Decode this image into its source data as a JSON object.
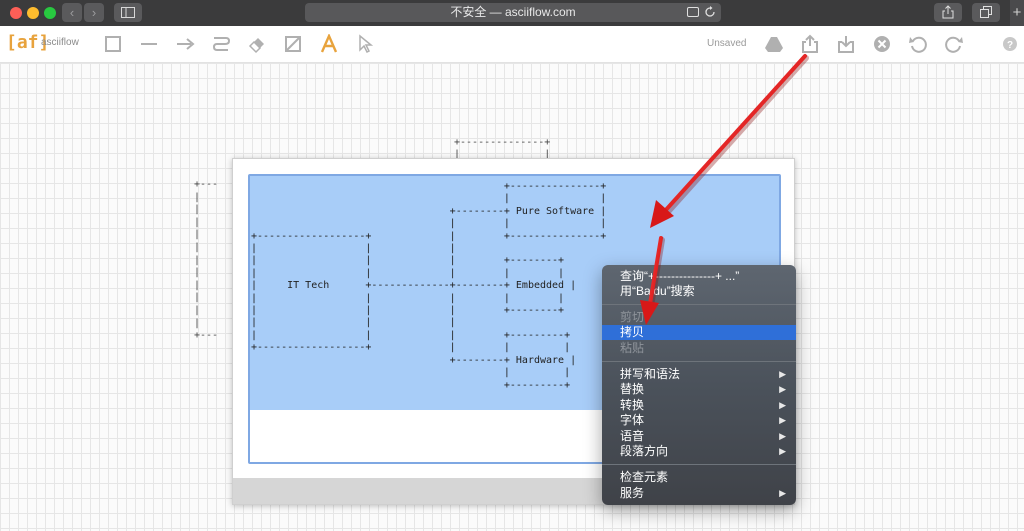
{
  "browser": {
    "url_text": "不安全 — asciiflow.com",
    "nav": {
      "back_glyph": "‹",
      "forward_glyph": "›"
    },
    "new_tab_glyph": "+"
  },
  "app": {
    "logo": "[af]",
    "name": "asciiflow",
    "status": "Unsaved",
    "accent_color": "#e8a33d"
  },
  "diagram": {
    "back_box_top": "+--------------+\n|              |",
    "back_box_left": "+---\n|\n|\n|\n|\n|\n|\n|\n|\n|\n|\n|\n+---",
    "text": "                                          +---------------+\n                                          |               |\n                                 +--------+ Pure Software |\n                                 |        |               |\n+------------------+             |        +---------------+\n|                  |             |\n|                  |             |        +--------+\n|                  |             |        |        |\n|     IT Tech      +-------------+--------+ Embedded |\n|                  |             |        |        |\n|                  |             |        +--------+\n|                  |             |\n|                  |             |        +---------+\n+------------------+             |        |         |\n                                 +--------+ Hardware |\n                                          |         |\n                                          +---------+"
  },
  "context_menu": {
    "lookup": "查询“+---------------+ ...”",
    "search": "用“Baidu”搜索",
    "cut": "剪切",
    "copy": "拷贝",
    "paste": "粘贴",
    "spelling": "拼写和语法",
    "substitutions": "替换",
    "transformations": "转换",
    "font": "字体",
    "speech": "语音",
    "direction": "段落方向",
    "inspect": "检查元素",
    "services": "服务",
    "submenu_glyph": "▶"
  },
  "colors": {
    "selection": "#a8cdf8",
    "menu_highlight": "#2f6fd8",
    "annotation_arrow": "#e02020"
  }
}
